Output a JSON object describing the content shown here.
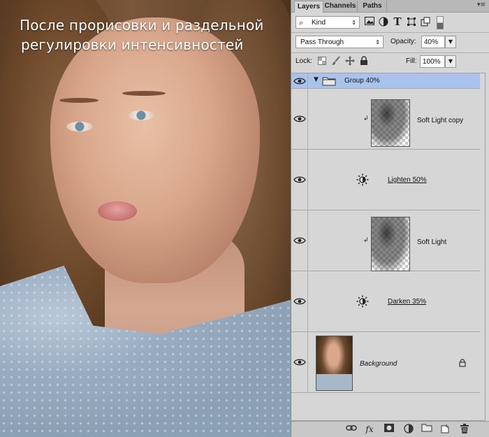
{
  "caption": {
    "line1": "После прорисовки и раздельной",
    "line2": "регулировки интенсивностей"
  },
  "tabs": [
    {
      "label": "Layers"
    },
    {
      "label": "Channels"
    },
    {
      "label": "Paths"
    }
  ],
  "filter": {
    "search_icon": "⌕",
    "kind_label": "Kind"
  },
  "blend": {
    "mode": "Pass Through",
    "opacity_label": "Opacity:",
    "opacity_value": "40%",
    "lock_label": "Lock:",
    "fill_label": "Fill:",
    "fill_value": "100%"
  },
  "layers": [
    {
      "name": "Group 40%",
      "type": "group"
    },
    {
      "name": "Soft Light copy",
      "type": "clipped"
    },
    {
      "name": "Lighten 50%",
      "type": "adjustment"
    },
    {
      "name": "Soft Light",
      "type": "clipped"
    },
    {
      "name": "Darken 35%",
      "type": "adjustment"
    },
    {
      "name": "Background",
      "type": "background"
    }
  ],
  "colors": {
    "selected_row": "#a9c3ec",
    "panel_bg": "#d6d6d6"
  }
}
